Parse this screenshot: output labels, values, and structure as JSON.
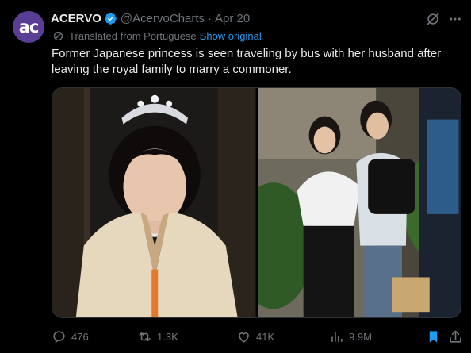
{
  "author": {
    "avatar_text": "ac",
    "name": "ACERVO",
    "handle": "@AcervoCharts",
    "separator": "·",
    "date": "Apr 20"
  },
  "translation": {
    "notice": "Translated from Portuguese",
    "show_original": "Show original"
  },
  "tweet": {
    "text": "Former Japanese princess is seen traveling by bus with her husband after leaving the royal family to marry a commoner."
  },
  "media": {
    "photos": [
      {
        "icon": "photo-portrait-tiara"
      },
      {
        "icon": "photo-couple-street"
      }
    ]
  },
  "actions": {
    "reply_count": "476",
    "retweet_count": "1.3K",
    "like_count": "41K",
    "view_count": "9.9M"
  },
  "colors": {
    "background": "#000000",
    "text": "#e7e9ea",
    "muted": "#71767b",
    "link": "#1d9bf0",
    "avatar": "#5a3e96"
  }
}
